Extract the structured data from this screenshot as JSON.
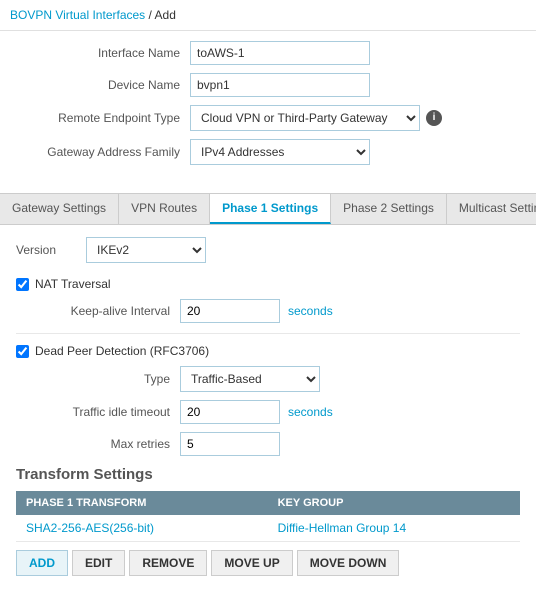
{
  "breadcrumb": {
    "parent": "BOVPN Virtual Interfaces",
    "separator": "/",
    "current": "Add"
  },
  "form": {
    "interface_name_label": "Interface Name",
    "interface_name_value": "toAWS-1",
    "device_name_label": "Device Name",
    "device_name_value": "bvpn1",
    "remote_endpoint_label": "Remote Endpoint Type",
    "remote_endpoint_value": "Cloud VPN or Third-Party Gateway",
    "gateway_address_label": "Gateway Address Family",
    "gateway_address_value": "IPv4 Addresses"
  },
  "tabs": [
    {
      "id": "gateway",
      "label": "Gateway Settings",
      "active": false
    },
    {
      "id": "vpn-routes",
      "label": "VPN Routes",
      "active": false
    },
    {
      "id": "phase1",
      "label": "Phase 1 Settings",
      "active": true
    },
    {
      "id": "phase2",
      "label": "Phase 2 Settings",
      "active": false
    },
    {
      "id": "multicast",
      "label": "Multicast Settings",
      "active": false
    }
  ],
  "phase1": {
    "version_label": "Version",
    "version_value": "IKEv2",
    "nat_traversal": {
      "label": "NAT Traversal",
      "checked": true,
      "keepalive_label": "Keep-alive Interval",
      "keepalive_value": "20",
      "keepalive_unit": "seconds"
    },
    "dead_peer": {
      "label": "Dead Peer Detection (RFC3706)",
      "checked": true,
      "type_label": "Type",
      "type_value": "Traffic-Based",
      "idle_label": "Traffic idle timeout",
      "idle_value": "20",
      "idle_unit": "seconds",
      "retries_label": "Max retries",
      "retries_value": "5"
    }
  },
  "transform_settings": {
    "title": "Transform Settings",
    "table": {
      "col1": "PHASE 1 TRANSFORM",
      "col2": "KEY GROUP",
      "rows": [
        {
          "transform": "SHA2-256-AES(256-bit)",
          "key_group": "Diffie-Hellman Group 14"
        }
      ]
    }
  },
  "action_buttons": [
    {
      "id": "add",
      "label": "ADD"
    },
    {
      "id": "edit",
      "label": "EDIT"
    },
    {
      "id": "remove",
      "label": "REMOVE"
    },
    {
      "id": "move-up",
      "label": "MOVE UP"
    },
    {
      "id": "move-down",
      "label": "MOVE DOWN"
    }
  ]
}
